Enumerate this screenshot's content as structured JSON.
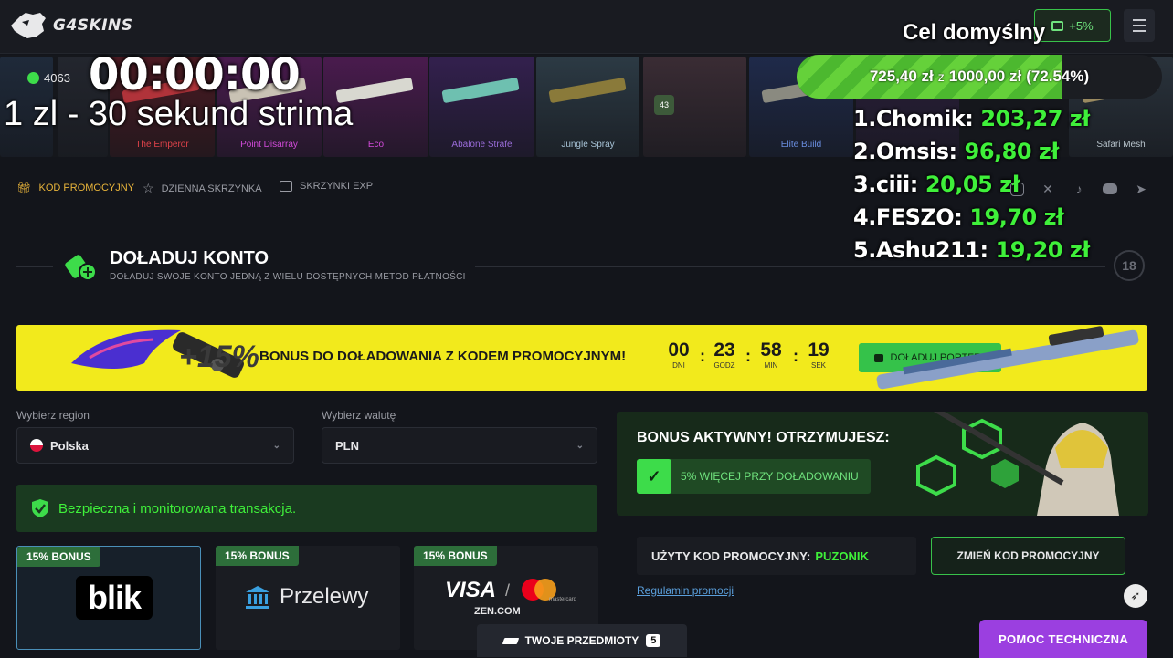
{
  "header": {
    "logo_text": "G4SKINS",
    "bonus_chip_label": "+5%",
    "goal_title": "Cel domyślny"
  },
  "stream_overlay": {
    "timer": "00:00:00",
    "rate_text": "1 zl - 30 sekund strima",
    "points": "4063",
    "goal": {
      "current": "725,40 zł",
      "connector": "z",
      "target": "1000,00 zł",
      "percent_label": "(72.54%)",
      "progress": 0.7254
    },
    "leaderboard": [
      {
        "rank": "1.",
        "name": "Chomik:",
        "amount": "203,27 zł"
      },
      {
        "rank": "2.",
        "name": "Omsis:",
        "amount": "96,80 zł"
      },
      {
        "rank": "3.",
        "name": "ciii:",
        "amount": "20,05 zł"
      },
      {
        "rank": "4.",
        "name": "FESZO:",
        "amount": "19,70 zł"
      },
      {
        "rank": "5.",
        "name": "Ashu211:",
        "amount": "19,20 zł"
      }
    ]
  },
  "cases": [
    {
      "name": "",
      "bg": "#1f2a3a"
    },
    {
      "name": "",
      "bg": "#23262e"
    },
    {
      "name": "The Emperor",
      "bg": "#4a1a22",
      "name_color": "#e0434a",
      "gun": "#b0333a"
    },
    {
      "name": "Point Disarray",
      "bg": "#4a1b4e",
      "name_color": "#d14ad9",
      "gun": "#c9c2b4"
    },
    {
      "name": "Eco",
      "bg": "#4a1b4e",
      "name_color": "#d14ad9",
      "gun": "#d8d8d0"
    },
    {
      "name": "Abalone Strafe",
      "bg": "#33204e",
      "name_color": "#9a6cd9",
      "gun": "#6ec0b0"
    },
    {
      "name": "Jungle Spray",
      "bg": "#2c3a44",
      "name_color": "#a8c4d8",
      "gun": "#8a7a3a"
    },
    {
      "name": "",
      "bg": "#3a2c34",
      "extra_label": "43"
    },
    {
      "name": "Elite Build",
      "bg": "#1f2a4a",
      "name_color": "#6a8ee0",
      "gun": "#8a8a80"
    },
    {
      "name": "",
      "bg": "#2a1f3a"
    },
    {
      "name": "Safari Mesh",
      "bg": "#2a333c",
      "name_color": "#b8c4cc",
      "gun": "#9a8a60"
    }
  ],
  "subnav": {
    "items": [
      {
        "label": "KOD PROMOCYJNY",
        "icon": "gift-icon",
        "active": true
      },
      {
        "label": "DZIENNA SKRZYNKA",
        "icon": "star-icon",
        "active": false
      },
      {
        "label": "SKRZYNKI EXP",
        "icon": "box-icon",
        "active": false
      }
    ],
    "socials": [
      "instagram-icon",
      "x-icon",
      "tiktok-icon",
      "discord-icon",
      "telegram-icon"
    ]
  },
  "section": {
    "title": "DOŁADUJ KONTO",
    "subtitle": "DOŁADUJ SWOJE KONTO JEDNĄ Z WIELU DOSTĘPNYCH METOD PŁATNOŚCI",
    "age_badge": "18"
  },
  "banner": {
    "plus_text": "+15%",
    "text": "BONUS DO DOŁADOWANIA Z KODEM PROMOCYJNYM!",
    "countdown": [
      {
        "value": "00",
        "label": "DNI"
      },
      {
        "value": "23",
        "label": "GODZ"
      },
      {
        "value": "58",
        "label": "MIN"
      },
      {
        "value": "19",
        "label": "SEK"
      }
    ],
    "button_label": "DOŁADUJ PORTFEL"
  },
  "form": {
    "region_label": "Wybierz region",
    "region_value": "Polska",
    "currency_label": "Wybierz walutę",
    "currency_value": "PLN",
    "secure_text": "Bezpieczna i monitorowana transakcja."
  },
  "payment_methods": [
    {
      "badge": "15% BONUS",
      "name": "blik",
      "selected": true
    },
    {
      "badge": "15% BONUS",
      "name": "Przelewy",
      "selected": false
    },
    {
      "badge": "15% BONUS",
      "name": "VISA",
      "sub": "ZEN.COM",
      "mc_label": "mastercard",
      "separator": "/",
      "selected": false
    }
  ],
  "bonus_panel": {
    "heading": "BONUS AKTYWNY! OTRZYMUJESZ:",
    "perk": "5% WIĘCEJ PRZY DOŁADOWANIU"
  },
  "promo": {
    "used_label": "UŻYTY KOD PROMOCYJNY:",
    "code": "PUZONIK",
    "change_button": "ZMIEŃ KOD PROMOCYJNY",
    "terms_link": "Regulamin promocji"
  },
  "footer": {
    "items_button": "TWOJE PRZEDMIOTY",
    "items_count": "5",
    "help_button": "POMOC TECHNICZNA"
  },
  "colors": {
    "accent_green": "#3ff03a",
    "banner_yellow": "#f2ea1c",
    "help_purple": "#9b3fe0"
  }
}
